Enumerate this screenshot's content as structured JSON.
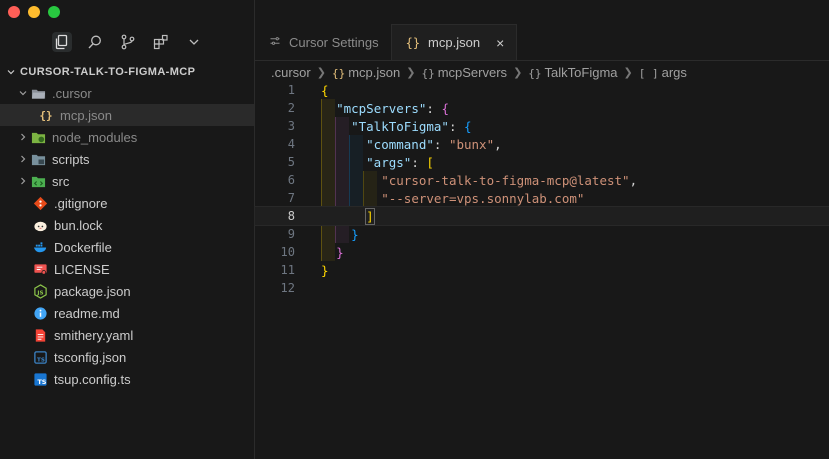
{
  "window": {
    "traffic_lights": [
      "close",
      "minimize",
      "maximize"
    ]
  },
  "activity_bar": {
    "items": [
      {
        "icon": "files-icon",
        "active": true
      },
      {
        "icon": "search-icon",
        "active": false
      },
      {
        "icon": "source-control-icon",
        "active": false
      },
      {
        "icon": "extensions-icon",
        "active": false
      },
      {
        "icon": "chevron-down-icon",
        "active": false
      }
    ]
  },
  "explorer": {
    "project_title": "CURSOR-TALK-TO-FIGMA-MCP",
    "items": [
      {
        "label": ".cursor",
        "type": "folder",
        "expanded": true
      },
      {
        "label": "mcp.json",
        "type": "json"
      },
      {
        "label": "node_modules",
        "type": "folder"
      },
      {
        "label": "scripts",
        "type": "folder"
      },
      {
        "label": "src",
        "type": "folder"
      },
      {
        "label": ".gitignore",
        "type": "git"
      },
      {
        "label": "bun.lock",
        "type": "bun"
      },
      {
        "label": "Dockerfile",
        "type": "docker"
      },
      {
        "label": "LICENSE",
        "type": "license"
      },
      {
        "label": "package.json",
        "type": "npm"
      },
      {
        "label": "readme.md",
        "type": "info"
      },
      {
        "label": "smithery.yaml",
        "type": "yaml"
      },
      {
        "label": "tsconfig.json",
        "type": "tsconfig"
      },
      {
        "label": "tsup.config.ts",
        "type": "ts"
      }
    ]
  },
  "tabs": [
    {
      "label": "Cursor Settings",
      "icon": "settings-icon",
      "active": false
    },
    {
      "label": "mcp.json",
      "icon": "{}",
      "active": true,
      "close": "×"
    }
  ],
  "breadcrumb": [
    {
      "label": ".cursor",
      "icon": ""
    },
    {
      "label": "mcp.json",
      "icon": "{}"
    },
    {
      "label": "mcpServers",
      "icon": "{}"
    },
    {
      "label": "TalkToFigma",
      "icon": "{}"
    },
    {
      "label": "args",
      "icon": "[ ]"
    }
  ],
  "code": {
    "current_line": 8,
    "lines": [
      {
        "n": "1",
        "text": "{"
      },
      {
        "n": "2",
        "text": "\"mcpServers\": {"
      },
      {
        "n": "3",
        "text": "\"TalkToFigma\": {"
      },
      {
        "n": "4",
        "text": "\"command\": \"bunx\","
      },
      {
        "n": "5",
        "text": "\"args\": ["
      },
      {
        "n": "6",
        "text": "\"cursor-talk-to-figma-mcp@latest\","
      },
      {
        "n": "7",
        "text": "\"--server=vps.sonnylab.com\""
      },
      {
        "n": "8",
        "text": "]"
      },
      {
        "n": "9",
        "text": "}"
      },
      {
        "n": "10",
        "text": "}"
      },
      {
        "n": "11",
        "text": "}"
      },
      {
        "n": "12",
        "text": ""
      }
    ]
  },
  "colors": {
    "background": "#181818",
    "key": "#9cdcfe",
    "string": "#ce9178",
    "bracket_gold": "#ffd700",
    "bracket_purple": "#da70d6",
    "bracket_blue": "#179fff"
  }
}
